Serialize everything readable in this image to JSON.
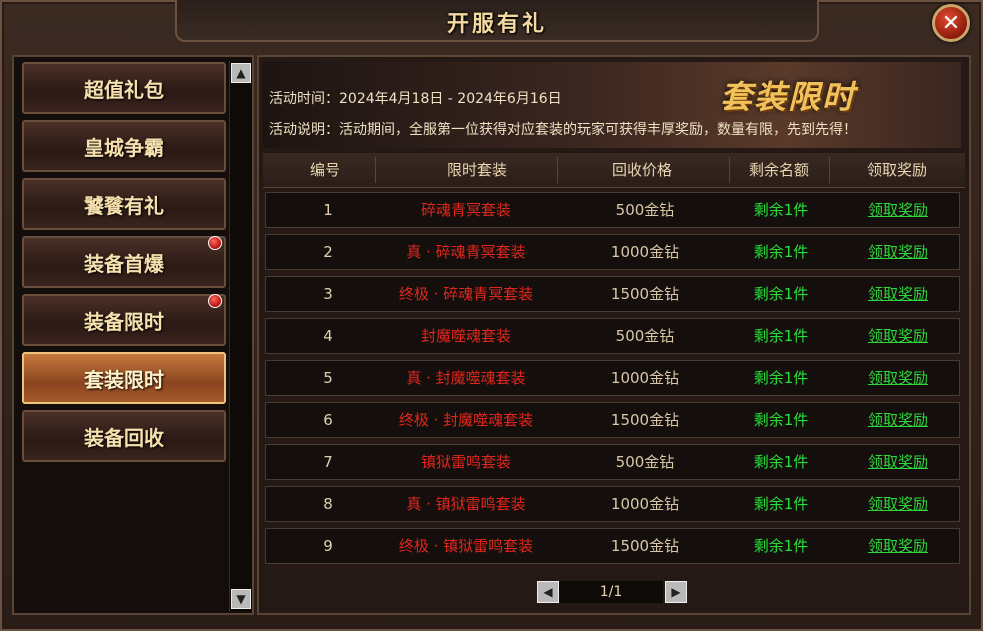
{
  "window": {
    "title": "开服有礼",
    "close_icon": "close-icon"
  },
  "sidebar": {
    "items": [
      {
        "label": "超值礼包",
        "badge": false,
        "active": false
      },
      {
        "label": "皇城争霸",
        "badge": false,
        "active": false
      },
      {
        "label": "饕餮有礼",
        "badge": false,
        "active": false
      },
      {
        "label": "装备首爆",
        "badge": true,
        "active": false
      },
      {
        "label": "装备限时",
        "badge": true,
        "active": false
      },
      {
        "label": "套装限时",
        "badge": false,
        "active": true
      },
      {
        "label": "装备回收",
        "badge": false,
        "active": false
      }
    ]
  },
  "banner": {
    "title": "套装限时",
    "time": "活动时间：2024年4月18日 - 2024年6月16日",
    "desc": "活动说明：活动期间，全服第一位获得对应套装的玩家可获得丰厚奖励，数量有限，先到先得！"
  },
  "table": {
    "headers": [
      "编号",
      "限时套装",
      "回收价格",
      "剩余名额",
      "领取奖励"
    ],
    "rows": [
      {
        "no": "1",
        "name": "碎魂青冥套装",
        "price": "500金钻",
        "left": "剩余1件",
        "claim": "领取奖励"
      },
      {
        "no": "2",
        "name": "真 · 碎魂青冥套装",
        "price": "1000金钻",
        "left": "剩余1件",
        "claim": "领取奖励"
      },
      {
        "no": "3",
        "name": "终极 · 碎魂青冥套装",
        "price": "1500金钻",
        "left": "剩余1件",
        "claim": "领取奖励"
      },
      {
        "no": "4",
        "name": "封魔噬魂套装",
        "price": "500金钻",
        "left": "剩余1件",
        "claim": "领取奖励"
      },
      {
        "no": "5",
        "name": "真 · 封魔噬魂套装",
        "price": "1000金钻",
        "left": "剩余1件",
        "claim": "领取奖励"
      },
      {
        "no": "6",
        "name": "终极 · 封魔噬魂套装",
        "price": "1500金钻",
        "left": "剩余1件",
        "claim": "领取奖励"
      },
      {
        "no": "7",
        "name": "镇狱雷鸣套装",
        "price": "500金钻",
        "left": "剩余1件",
        "claim": "领取奖励"
      },
      {
        "no": "8",
        "name": "真 · 镇狱雷鸣套装",
        "price": "1000金钻",
        "left": "剩余1件",
        "claim": "领取奖励"
      },
      {
        "no": "9",
        "name": "终极 · 镇狱雷鸣套装",
        "price": "1500金钻",
        "left": "剩余1件",
        "claim": "领取奖励"
      }
    ]
  },
  "pager": {
    "page": "1/1"
  }
}
